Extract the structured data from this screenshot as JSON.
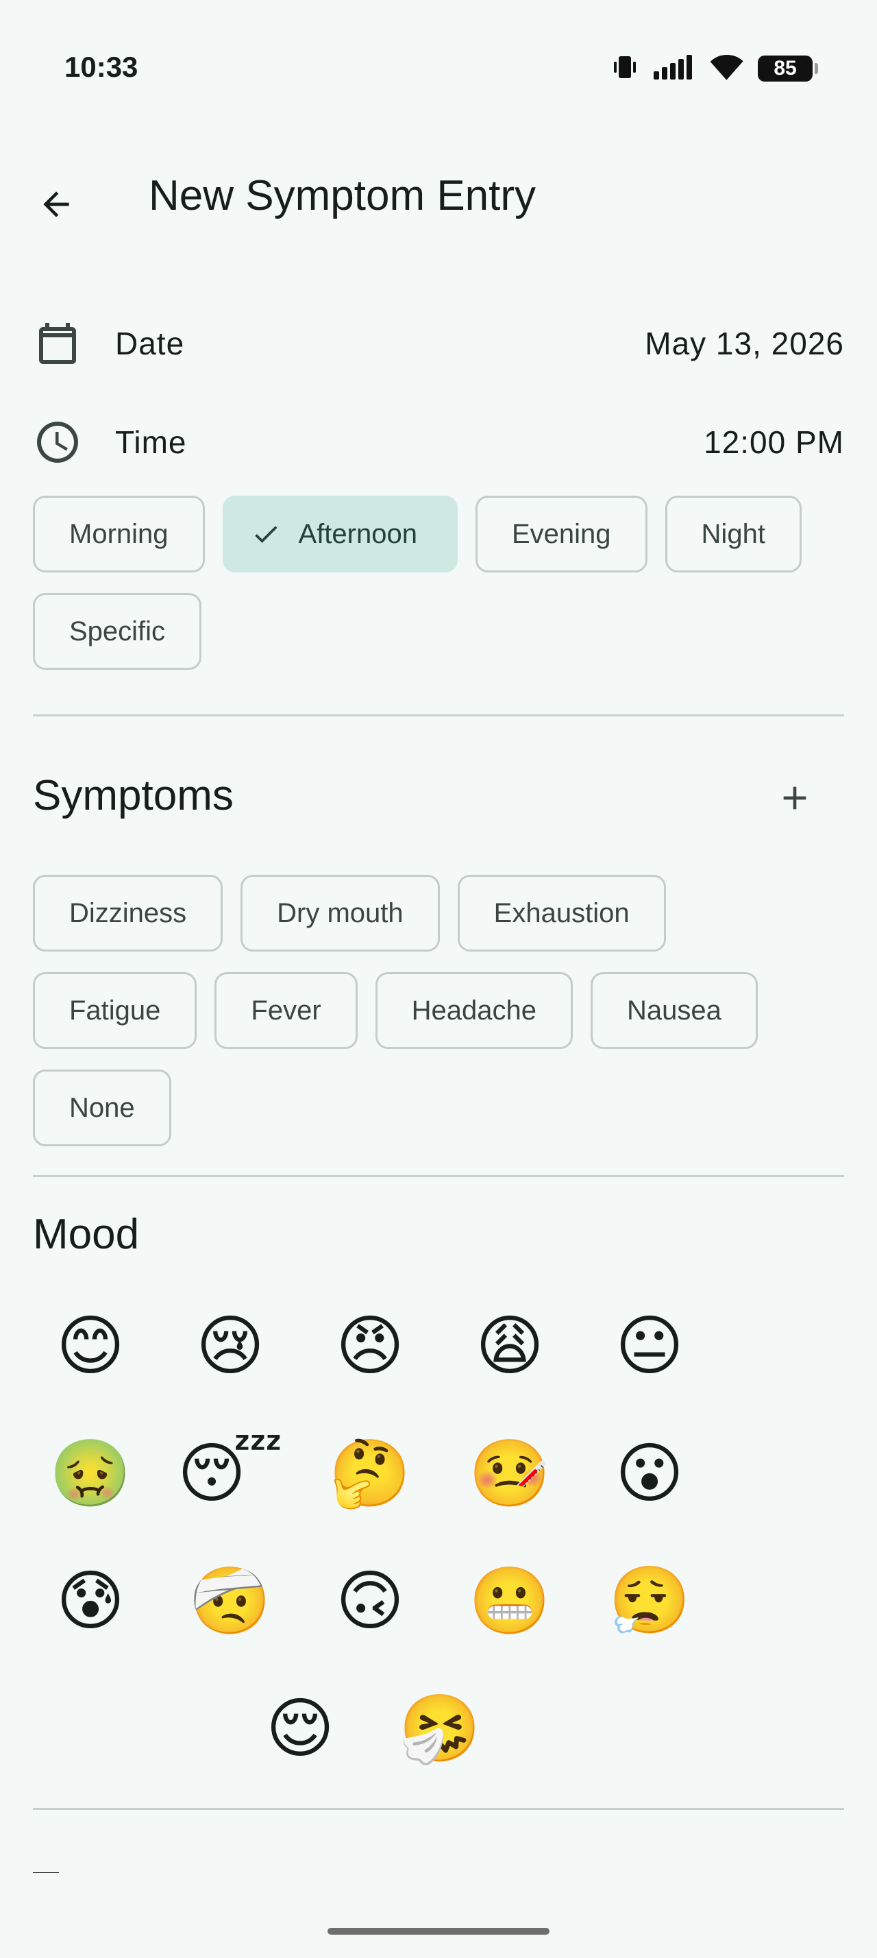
{
  "status_bar": {
    "time": "10:33",
    "battery": "85"
  },
  "app_bar": {
    "title": "New Symptom Entry"
  },
  "date_row": {
    "label": "Date",
    "value": "May 13, 2026"
  },
  "time_row": {
    "label": "Time",
    "value": "12:00 PM"
  },
  "time_of_day": {
    "options": [
      "Morning",
      "Afternoon",
      "Evening",
      "Night",
      "Specific"
    ],
    "selected": "Afternoon"
  },
  "symptoms": {
    "title": "Symptoms",
    "chips": [
      "Dizziness",
      "Dry mouth",
      "Exhaustion",
      "Fatigue",
      "Fever",
      "Headache",
      "Nausea",
      "None"
    ]
  },
  "mood": {
    "title": "Mood",
    "emojis": [
      "😊",
      "😢",
      "😠",
      "😩",
      "😐",
      "🤢",
      "😴",
      "🤔",
      "🤒",
      "😮",
      "😰",
      "🤕",
      "🙃",
      "😬",
      "😮‍💨",
      "😌",
      "🤧"
    ]
  },
  "colors": {
    "background": "#f4f9f7",
    "selected_chip": "#cfe8e2",
    "chip_border": "#c4cdc9",
    "text": "#161d1b"
  }
}
